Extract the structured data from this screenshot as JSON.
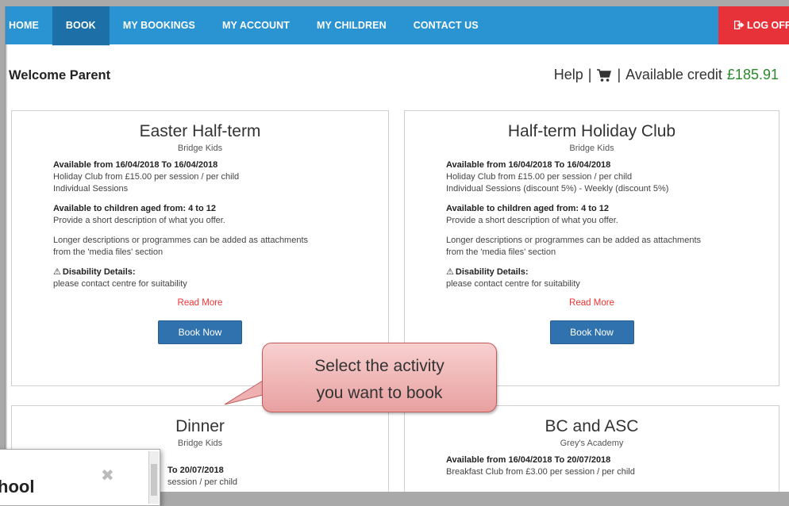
{
  "nav": {
    "items": [
      {
        "label": "HOME",
        "active": false
      },
      {
        "label": "BOOK",
        "active": true
      },
      {
        "label": "MY BOOKINGS",
        "active": false
      },
      {
        "label": "MY ACCOUNT",
        "active": false
      },
      {
        "label": "MY CHILDREN",
        "active": false
      },
      {
        "label": "CONTACT US",
        "active": false
      }
    ],
    "logoff": "LOG OFF",
    "logoff_icon": "sign-out-icon",
    "colors": {
      "bar": "#2a93d1",
      "active": "#1d6fa7",
      "logoff": "#e8323a"
    }
  },
  "header": {
    "welcome": "Welcome Parent",
    "help": "Help",
    "sep1": "|",
    "sep2": "|",
    "credit_label": "Available credit",
    "credit_value": "£185.91",
    "cart_icon": "cart-icon"
  },
  "cards": [
    {
      "title": "Easter Half-term",
      "provider": "Bridge Kids",
      "available": "Available from 16/04/2018 To 16/04/2018",
      "price": "Holiday Club from £15.00 per session / per child",
      "sessions": "Individual Sessions",
      "ages": "Available to children aged from: 4 to 12",
      "desc1": "Provide a short description of what you offer.",
      "desc2a": "Longer descriptions or programmes can be added as attachments",
      "desc2b": "from the 'media files' section",
      "disability_label": "Disability Details:",
      "disability_text": "please contact centre for suitability",
      "read_more": "Read More",
      "book": "Book Now"
    },
    {
      "title": "Half-term Holiday Club",
      "provider": "Bridge Kids",
      "available": "Available from 16/04/2018 To 16/04/2018",
      "price": "Holiday Club from £15.00 per session / per child",
      "sessions": "Individual Sessions (discount 5%) - Weekly (discount 5%)",
      "ages": "Available to children aged from: 4 to 12",
      "desc1": "Provide a short description of what you offer.",
      "desc2a": "Longer descriptions or programmes can be added as attachments",
      "desc2b": "from the 'media files' section",
      "disability_label": "Disability Details:",
      "disability_text": "please contact centre for suitability",
      "read_more": "Read More",
      "book": "Book Now"
    },
    {
      "title": "Dinner",
      "provider": "Bridge Kids",
      "available_partial": "To 20/07/2018",
      "price_partial": "session / per child"
    },
    {
      "title": "BC and ASC",
      "provider": "Grey's Academy",
      "available": "Available from 16/04/2018 To 20/07/2018",
      "price": "Breakfast Club from £3.00 per session / per child"
    }
  ],
  "callout": {
    "line1": "Select the activity",
    "line2": "you want to book"
  },
  "popup": {
    "title": "hool",
    "close": "✖"
  }
}
